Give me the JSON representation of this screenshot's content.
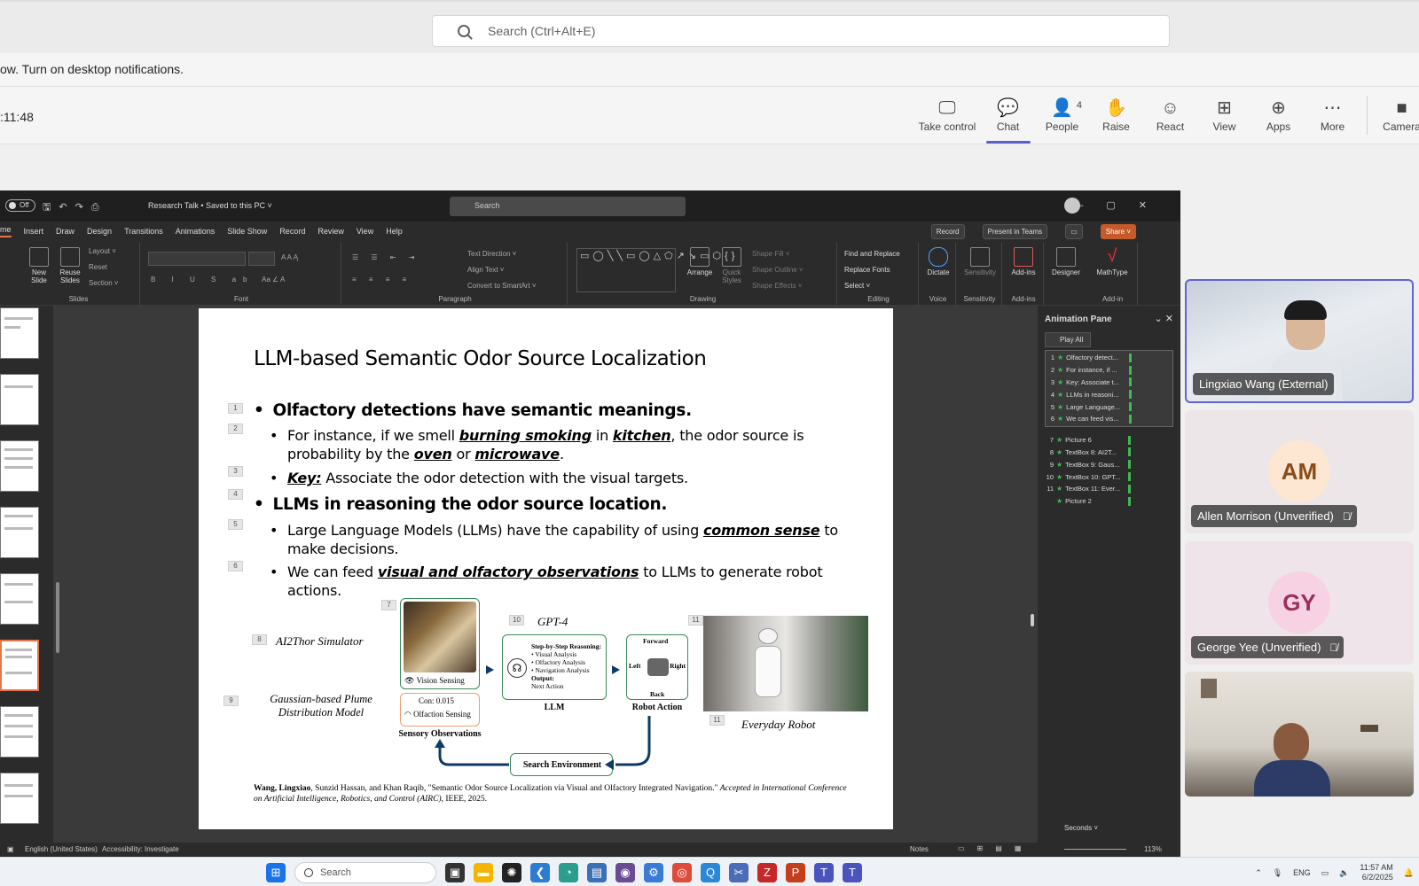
{
  "teams": {
    "search_placeholder": "Search (Ctrl+Alt+E)",
    "notification": "ow. Turn on desktop notifications.",
    "meeting_time": ":11:48",
    "actions": [
      {
        "label": "Take control",
        "icon": "screen-cursor-icon"
      },
      {
        "label": "Chat",
        "icon": "chat-icon"
      },
      {
        "label": "People",
        "icon": "people-icon",
        "count": "4"
      },
      {
        "label": "Raise",
        "icon": "hand-icon"
      },
      {
        "label": "React",
        "icon": "smile-icon"
      },
      {
        "label": "View",
        "icon": "grid-icon"
      },
      {
        "label": "Apps",
        "icon": "plus-square-icon"
      },
      {
        "label": "More",
        "icon": "ellipsis-icon"
      },
      {
        "label": "Camera",
        "icon": "camera-icon"
      }
    ],
    "active_action": "Chat",
    "accent": "#5b5fc7"
  },
  "ppt": {
    "toggle": "Off",
    "doc_title": "Research Talk • Saved to this PC ˅",
    "search": "Search",
    "tabs": [
      "me",
      "Insert",
      "Draw",
      "Design",
      "Transitions",
      "Animations",
      "Slide Show",
      "Record",
      "Review",
      "View",
      "Help"
    ],
    "right_buttons": {
      "record": "Record",
      "present": "Present in Teams",
      "share": "Share ˅"
    },
    "ribbon": {
      "slides": {
        "new_slide": "New Slide",
        "reuse": "Reuse Slides",
        "layout": "Layout ˅",
        "reset": "Reset",
        "section": "Section ˅",
        "label": "Slides"
      },
      "font_label": "Font",
      "paragraph": {
        "text_direction": "Text Direction ˅",
        "align_text": "Align Text ˅",
        "smartart": "Convert to SmartArt ˅",
        "label": "Paragraph"
      },
      "drawing": {
        "arrange": "Arrange",
        "quick_styles": "Quick Styles",
        "shape_fill": "Shape Fill ˅",
        "shape_outline": "Shape Outline ˅",
        "shape_effects": "Shape Effects ˅",
        "label": "Drawing"
      },
      "editing": {
        "find": "Find and Replace",
        "replace_fonts": "Replace Fonts",
        "select": "Select ˅",
        "label": "Editing"
      },
      "voice": {
        "dictate": "Dictate",
        "label": "Voice"
      },
      "sensitivity": {
        "btn": "Sensitivity",
        "label": "Sensitivity"
      },
      "addins": {
        "btn": "Add-ins",
        "label": "Add-ins"
      },
      "designer": "Designer",
      "mathtype": {
        "btn": "MathType",
        "label": "Add-in"
      }
    },
    "status": {
      "language": "English (United States)",
      "accessibility": "Accessibility: Investigate",
      "notes": "Notes",
      "zoom": "113%"
    }
  },
  "slide": {
    "title": "LLM-based Semantic Odor Source Localization",
    "bullet1": "Olfactory detections have semantic meanings.",
    "sub1_a": "For instance, if we smell ",
    "sub1_b": "burning smoking",
    "sub1_c": " in ",
    "sub1_d": "kitchen",
    "sub1_e": ", the odor source is probability by the ",
    "sub1_f": "oven",
    "sub1_g": " or ",
    "sub1_h": "microwave",
    "sub1_i": ".",
    "sub2_a": "Key:",
    "sub2_b": " Associate the odor detection with the visual targets.",
    "bullet2": "LLMs in reasoning the odor source location.",
    "sub3_a": "Large Language Models (LLMs) have the capability of using ",
    "sub3_b": "common sense",
    "sub3_c": " to make decisions.",
    "sub4_a": "We can feed ",
    "sub4_b": "visual and olfactory observations",
    "sub4_c": " to LLMs to generate robot actions.",
    "anim_nums": [
      "1",
      "2",
      "3",
      "4",
      "5",
      "6",
      "7",
      "8",
      "9",
      "10",
      "11",
      "11"
    ],
    "figure": {
      "ai2thor": "AI2Thor Simulator",
      "gaussian": "Gaussian-based Plume Distribution Model",
      "vision": "Vision Sensing",
      "con": "Con: 0.015",
      "olfaction": "Olfaction Sensing",
      "sensory": "Sensory Observations",
      "gpt4": "GPT-4",
      "reasoning_title": "Step-by-Step Reasoning:",
      "reasoning_items": [
        "• Visual Analysis",
        "• Olfactory Analysis",
        "• Navigation Analysis"
      ],
      "output": "Output:",
      "next_action": "Next Action",
      "llm": "LLM",
      "forward": "Forward",
      "left": "Left",
      "right": "Right",
      "back": "Back",
      "robot_action": "Robot Action",
      "everyday_robot": "Everyday Robot",
      "search_env": "Search Environment"
    },
    "cite_a": "Wang, Lingxiao",
    "cite_b": ", Sunzid Hassan, and Khan Raqib, \"Semantic Odor Source Localization via Visual and Olfactory Integrated Navigation.\" ",
    "cite_c": "Accepted in International Conference on Artificial Intelligence, Robotics, and Control (AIRC)",
    "cite_d": ", IEEE, 2025."
  },
  "animation_pane": {
    "title": "Animation Pane",
    "play_all": "Play All",
    "items": [
      {
        "n": "1",
        "label": "Olfactory detect..."
      },
      {
        "n": "2",
        "label": "For instance, if ..."
      },
      {
        "n": "3",
        "label": "Key: Associate t..."
      },
      {
        "n": "4",
        "label": "LLMs in reasoni..."
      },
      {
        "n": "5",
        "label": "Large Language..."
      },
      {
        "n": "6",
        "label": "We can feed vis..."
      },
      {
        "n": "7",
        "label": "Picture 6"
      },
      {
        "n": "8",
        "label": "TextBox 8: AI2T..."
      },
      {
        "n": "9",
        "label": "TextBox 9: Gaus..."
      },
      {
        "n": "10",
        "label": "TextBox 10: GPT..."
      },
      {
        "n": "11",
        "label": "TextBox 11: Ever..."
      },
      {
        "n": "",
        "label": "Picture 2"
      }
    ],
    "seconds": "Seconds ˅"
  },
  "participants": [
    {
      "name": "Lingxiao Wang (External)",
      "type": "video"
    },
    {
      "name": "Allen Morrison (Unverified)",
      "initials": "AM",
      "muted": true
    },
    {
      "name": "George Yee (Unverified)",
      "initials": "GY",
      "muted": true
    },
    {
      "name": "",
      "type": "video"
    }
  ],
  "taskbar": {
    "search": "Search",
    "lang": "ENG",
    "time": "11:57 AM",
    "date": "6/2/2025"
  }
}
